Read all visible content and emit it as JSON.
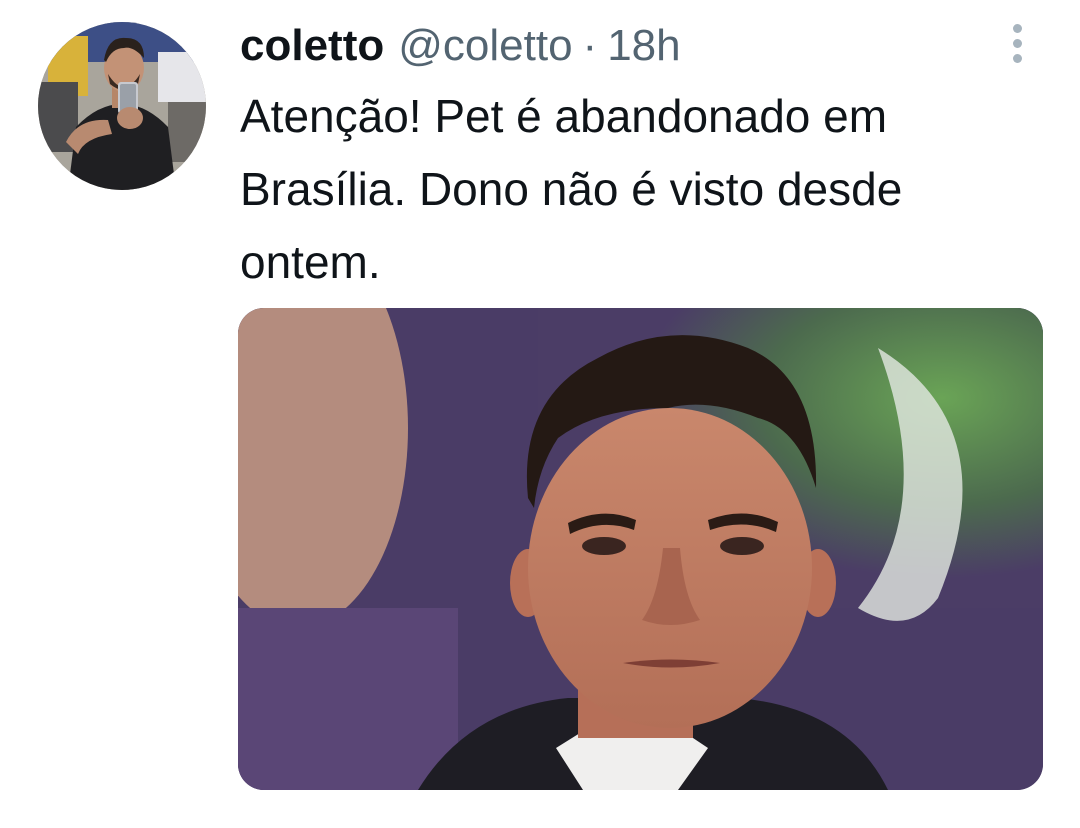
{
  "tweet": {
    "display_name": "coletto",
    "handle": "@coletto",
    "separator": "·",
    "time": "18h",
    "text": "Atenção! Pet é abandonado em Brasília. Dono não é visto desde ontem."
  },
  "avatar": {
    "icon": "profile-photo"
  },
  "more_menu": {
    "icon": "more-vertical-icon"
  },
  "media": {
    "description_icon": "photo"
  },
  "colors": {
    "text_primary": "#0f1419",
    "text_secondary": "#536471",
    "menu_dots": "#a7b4be",
    "background": "#ffffff"
  }
}
